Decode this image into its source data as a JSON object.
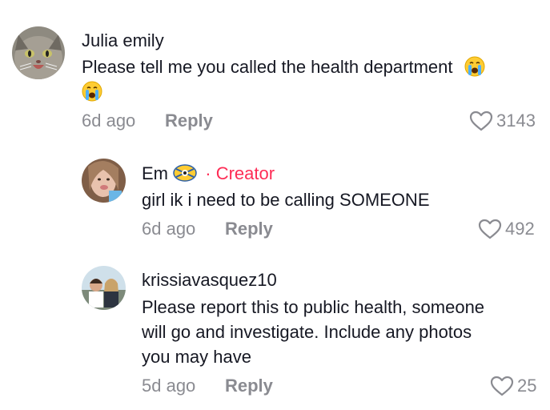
{
  "comments": [
    {
      "username": "Julia emily",
      "text": "Please tell me you called the health department",
      "time": "6d ago",
      "reply_label": "Reply",
      "likes": "3143"
    },
    {
      "username": "Em",
      "creator_sep": "·",
      "creator_label": "Creator",
      "text": "girl ik i need to be calling SOMEONE",
      "time": "6d ago",
      "reply_label": "Reply",
      "likes": "492"
    },
    {
      "username": "krissiavasquez10",
      "text_lines": [
        "Please report this to public health, someone",
        "will go and investigate. Include any photos",
        "you may have"
      ],
      "time": "5d ago",
      "reply_label": "Reply",
      "likes": "25"
    }
  ],
  "colors": {
    "accent_creator": "#fe2c55",
    "muted": "#8a8b91",
    "text": "#161823"
  },
  "icons": [
    "heart-outline-icon",
    "crying-face-emoji",
    "star-struck-emoji"
  ]
}
